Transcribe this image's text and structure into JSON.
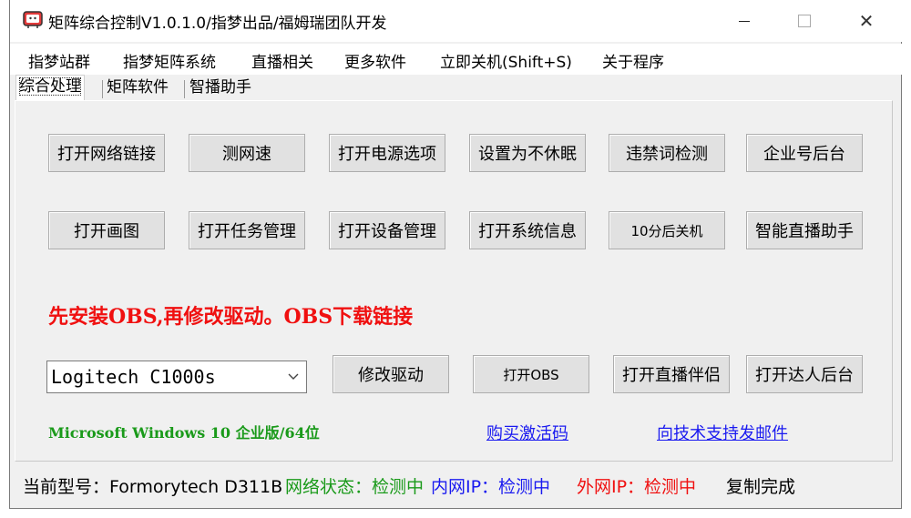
{
  "window": {
    "title": "矩阵综合控制V1.0.1.0/指梦出品/福姆瑞团队开发",
    "app_icon": "tv-icon",
    "controls": {
      "minimize": "minimize-icon",
      "maximize": "maximize-icon",
      "close": "✕"
    }
  },
  "menu": {
    "items": [
      {
        "label": "指梦站群"
      },
      {
        "label": "指梦矩阵系统"
      },
      {
        "label": "直播相关"
      },
      {
        "label": "更多软件"
      },
      {
        "label": "立即关机(Shift+S)"
      },
      {
        "label": "关于程序"
      }
    ]
  },
  "tabs": {
    "items": [
      {
        "label": "综合处理",
        "active": true
      },
      {
        "label": "矩阵软件",
        "active": false
      },
      {
        "label": "智播助手",
        "active": false
      }
    ]
  },
  "buttons": {
    "row1": [
      {
        "label": "打开网络链接"
      },
      {
        "label": "测网速"
      },
      {
        "label": "打开电源选项"
      },
      {
        "label": "设置为不休眠"
      },
      {
        "label": "违禁词检测"
      },
      {
        "label": "企业号后台"
      }
    ],
    "row2": [
      {
        "label": "打开画图"
      },
      {
        "label": "打开任务管理"
      },
      {
        "label": "打开设备管理"
      },
      {
        "label": "打开系统信息"
      },
      {
        "label": "10分后关机"
      },
      {
        "label": "智能直播助手"
      }
    ],
    "row3": [
      {
        "label": "修改驱动"
      },
      {
        "label": "打开OBS"
      },
      {
        "label": "打开直播伴侣"
      },
      {
        "label": "打开达人后台"
      }
    ]
  },
  "notice": {
    "text": "先安装OBS,再修改驱动。OBS下载链接",
    "color": "#f01010"
  },
  "device_select": {
    "value": "Logitech C1000s"
  },
  "os_info": {
    "text": "Microsoft Windows 10 企业版/64位",
    "color": "#1a9a1a"
  },
  "links": {
    "buy": "购买激活码",
    "email": "向技术支持发邮件"
  },
  "status": {
    "model": "当前型号：Formorytech  D311B",
    "network": "网络状态：检测中",
    "lan_ip": "内网IP：检测中",
    "wan_ip": "外网IP：检测中",
    "copy": "复制完成",
    "colors": {
      "network": "#1a9a1a",
      "lan_ip": "#1a1af0",
      "wan_ip": "#f01010"
    }
  }
}
